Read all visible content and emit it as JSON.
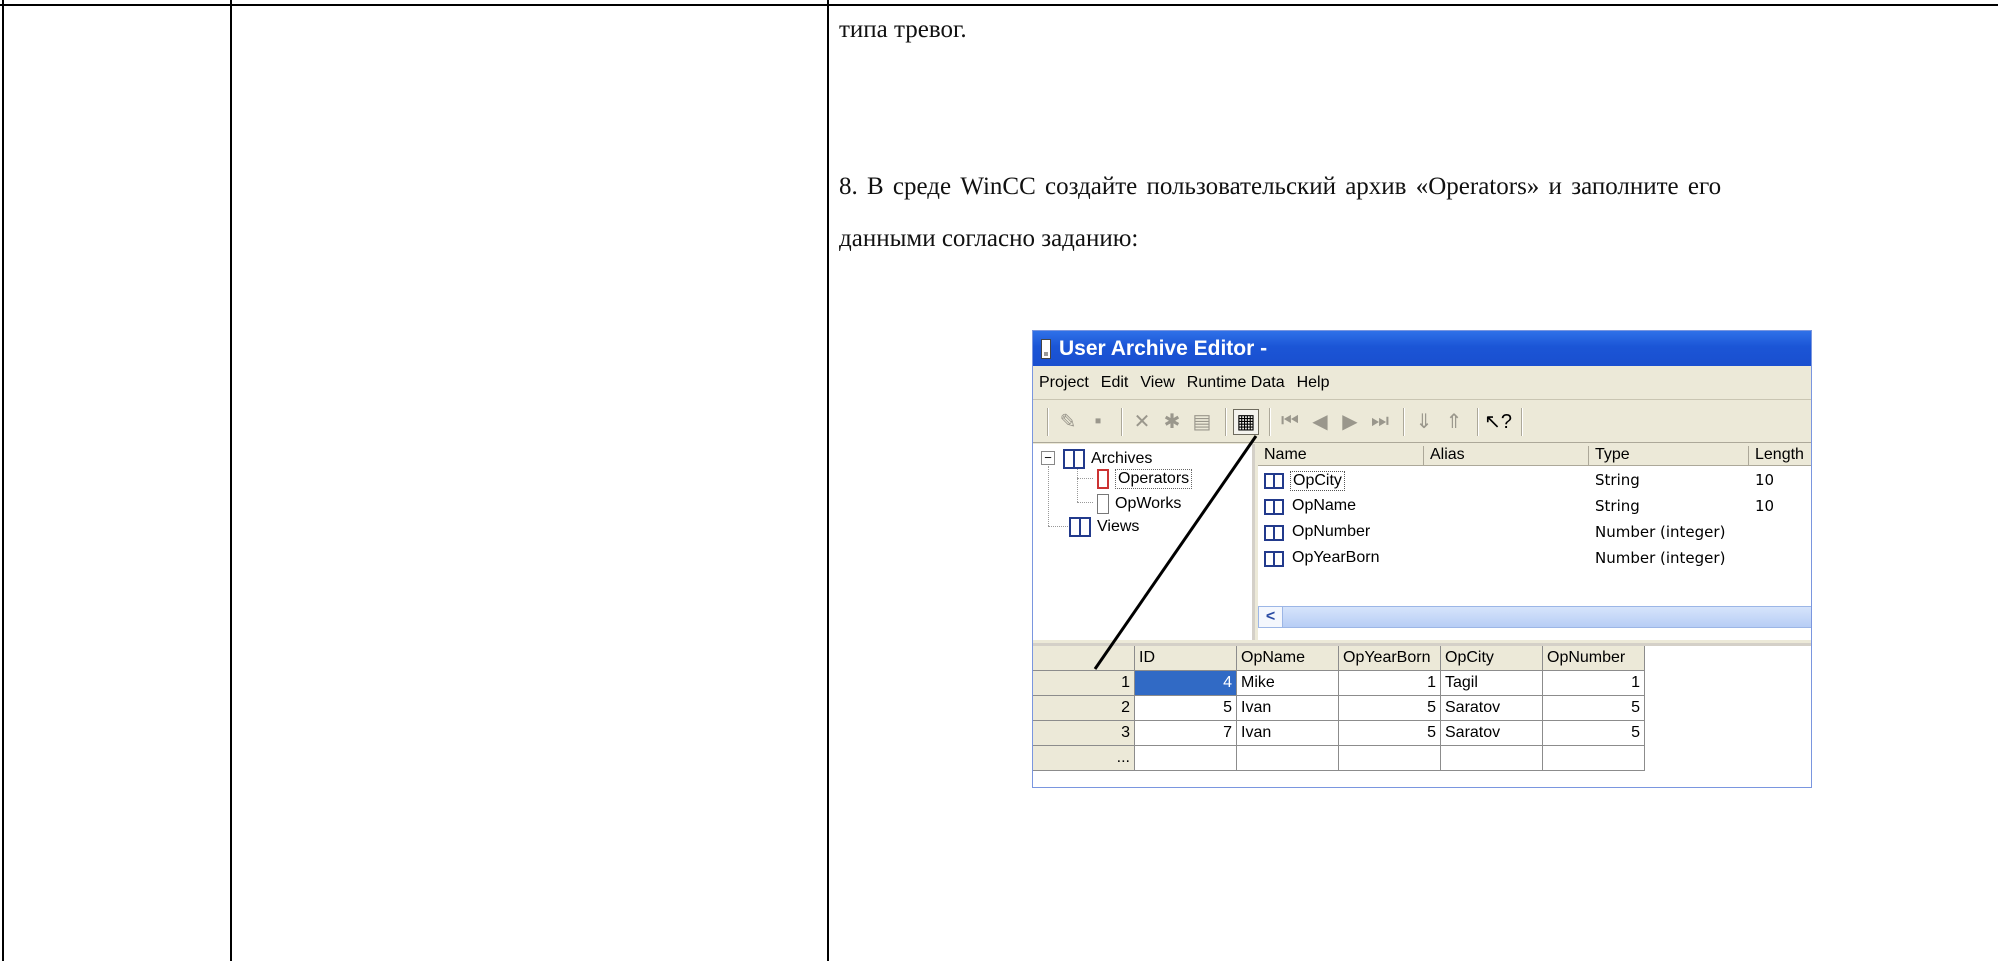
{
  "document": {
    "line_top": "типа тревог.",
    "step_line1": "8. В среде WinCC создайте пользовательский архив «Operators» и заполните его",
    "step_line2": "данными согласно заданию:"
  },
  "window": {
    "title": "User Archive Editor -",
    "menu": [
      "Project",
      "Edit",
      "View",
      "Runtime Data",
      "Help"
    ]
  },
  "tree": {
    "root": "Archives",
    "children": [
      "Operators",
      "OpWorks"
    ],
    "views": "Views"
  },
  "fields_list": {
    "headers": [
      "Name",
      "Alias",
      "Type",
      "Length"
    ],
    "rows": [
      {
        "name": "OpCity",
        "alias": "",
        "type": "String",
        "length": "10"
      },
      {
        "name": "OpName",
        "alias": "",
        "type": "String",
        "length": "10"
      },
      {
        "name": "OpNumber",
        "alias": "",
        "type": "Number (integer)",
        "length": ""
      },
      {
        "name": "OpYearBorn",
        "alias": "",
        "type": "Number (integer)",
        "length": ""
      }
    ]
  },
  "data_grid": {
    "headers": [
      "ID",
      "OpName",
      "OpYearBorn",
      "OpCity",
      "OpNumber"
    ],
    "rows": [
      {
        "n": "1",
        "id": "4",
        "name": "Mike",
        "year": "1",
        "city": "Tagil",
        "num": "1"
      },
      {
        "n": "2",
        "id": "5",
        "name": "Ivan",
        "year": "5",
        "city": "Saratov",
        "num": "5"
      },
      {
        "n": "3",
        "id": "7",
        "name": "Ivan",
        "year": "5",
        "city": "Saratov",
        "num": "5"
      }
    ],
    "new_row_marker": "..."
  },
  "colors": {
    "titlebar": "#1b55d6",
    "selection": "#316ac5",
    "chrome": "#ece9d8"
  }
}
